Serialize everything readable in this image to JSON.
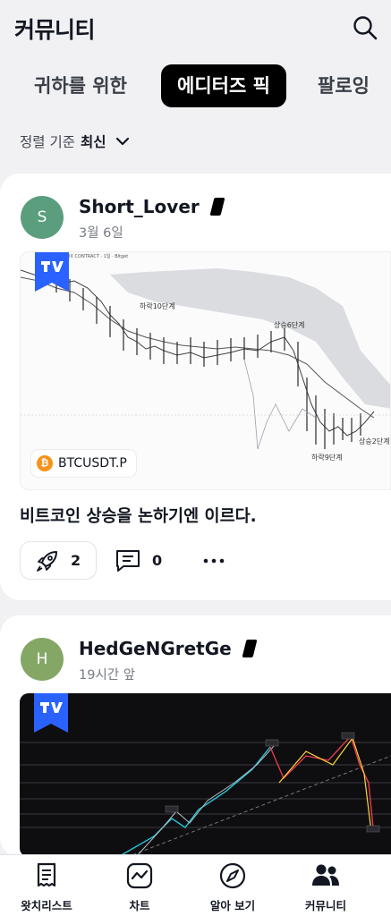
{
  "header": {
    "title": "커뮤니티",
    "search_icon": "search-icon"
  },
  "tabs": [
    {
      "label": "귀하를 위한",
      "active": false
    },
    {
      "label": "에디터즈 픽",
      "active": true
    },
    {
      "label": "팔로잉",
      "active": false
    }
  ],
  "sort": {
    "label": "정렬 기준",
    "value": "최신"
  },
  "posts": [
    {
      "avatar_letter": "S",
      "avatar_color": "#5a9e7e",
      "username": "Short_Lover",
      "time": "3월 6일",
      "chart": {
        "header_text": "CETUAL FIX CONTRACT · 1일 · Bitget",
        "labels": [
          "하락10단계",
          "상승6단계",
          "상승2단계",
          "하락9단계"
        ],
        "symbol": "BTCUSDT.P"
      },
      "title": "비트코인 상승을 논하기엔 이르다.",
      "boosts": "2",
      "comments": "0"
    },
    {
      "avatar_letter": "H",
      "avatar_color": "#85a766",
      "username": "HedGeNGretGe",
      "time": "19시간 앞"
    }
  ],
  "bottom_nav": [
    {
      "label": "왓치리스트",
      "icon": "watchlist-icon"
    },
    {
      "label": "차트",
      "icon": "chart-icon"
    },
    {
      "label": "알아 보기",
      "icon": "compass-icon"
    },
    {
      "label": "커뮤니티",
      "icon": "community-icon"
    }
  ]
}
